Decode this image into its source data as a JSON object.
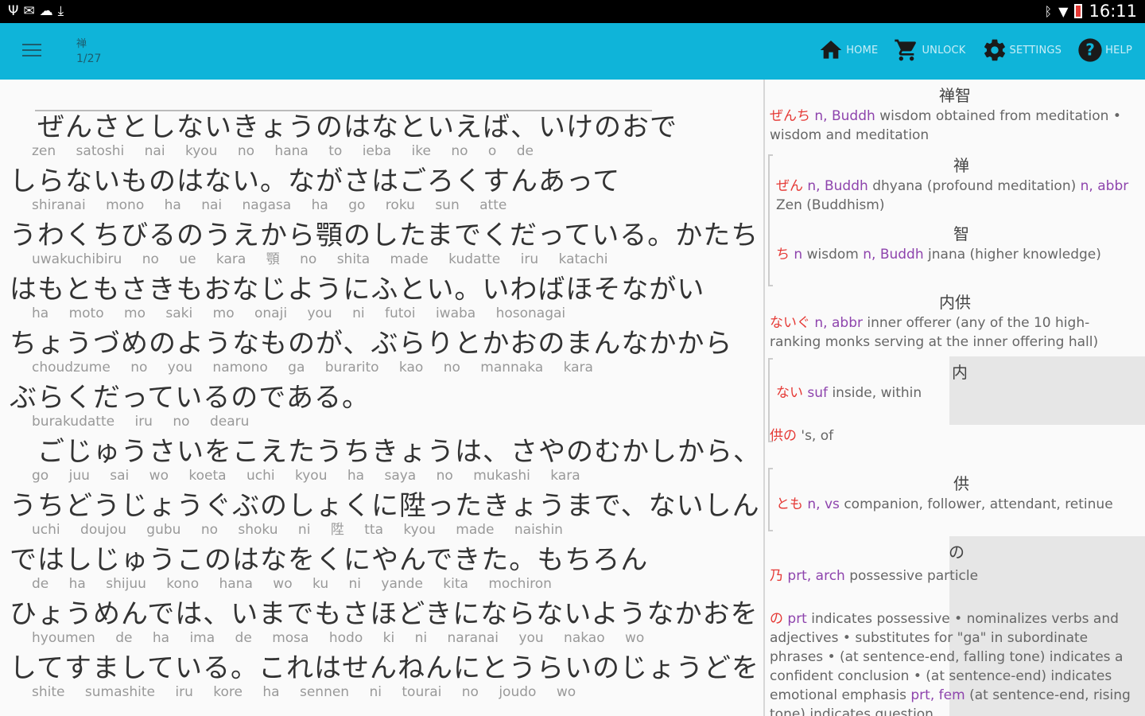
{
  "status_bar": {
    "left_icons": [
      "usb-icon",
      "email-icon",
      "cloud-upload-icon",
      "download-icon"
    ],
    "right_icons": [
      "bluetooth-icon",
      "wifi-icon",
      "battery-icon"
    ],
    "time": "16:11"
  },
  "app_bar": {
    "title": "禅",
    "subtitle": "1/27",
    "actions": [
      {
        "label": "HOME",
        "icon": "home-icon"
      },
      {
        "label": "UNLOCK",
        "icon": "cart-icon"
      },
      {
        "label": "SETTINGS",
        "icon": "gear-icon"
      },
      {
        "label": "HELP",
        "icon": "help-icon"
      }
    ]
  },
  "text_lines": [
    {
      "jp": "　ぜんさとしないきょうのはなといえば、いけのおで",
      "romaji": "zen satoshi nai kyou no hana to ieba ike no o de"
    },
    {
      "jp": "しらないものはない。ながさはごろくすんあって",
      "romaji": "shiranai mono ha nai nagasa ha go roku sun atte"
    },
    {
      "jp": "うわくちびるのうえから顎のしたまでくだっている。かたち",
      "romaji": "uwakuchibiru no ue kara 顎 no shita made kudatte iru katachi"
    },
    {
      "jp": "はもともさきもおなじようにふとい。いわばほそながい",
      "romaji": "ha moto mo saki mo onaji you ni futoi iwaba hosonagai"
    },
    {
      "jp": "ちょうづめのようなものが、ぶらりとかおのまんなかから",
      "romaji": "choudzume no you namono ga burarito kao no mannaka kara"
    },
    {
      "jp": "ぶらくだっているのである。",
      "romaji": "burakudatte iru no dearu"
    },
    {
      "jp": "　ごじゅうさいをこえたうちきょうは、さやのむかしから、",
      "romaji": "go juu sai wo koeta uchi kyou ha saya no mukashi kara"
    },
    {
      "jp": "うちどうじょうぐぶのしょくに陞ったきょうまで、ないしん",
      "romaji": "uchi doujou gubu no shoku ni 陞 tta kyou made naishin"
    },
    {
      "jp": "ではしじゅうこのはなをくにやんできた。もちろん",
      "romaji": "de ha shijuu kono hana wo ku ni yande kita mochiron"
    },
    {
      "jp": "ひょうめんでは、いまでもさほどきにならないようなかおを",
      "romaji": "hyoumen de ha ima de mosa hodo ki ni naranai you nakao wo"
    },
    {
      "jp": "してすましている。これはせんねんにとうらいのじょうどを",
      "romaji": "shite sumashite iru kore ha sennen ni tourai no joudo wo"
    }
  ],
  "dictionary": [
    {
      "kanji": "禅智",
      "reading": "ぜんち",
      "def": "n, Buddh wisdom obtained from meditation • wisdom and meditation"
    },
    {
      "kanji": "禅",
      "reading": "ぜん",
      "def": "n, Buddh dhyana (profound meditation) n, abbr Zen (Buddhism)"
    },
    {
      "kanji": "智",
      "reading": "ち",
      "def": "n wisdom n, Buddh jnana (higher knowledge)"
    },
    {
      "kanji": "内供",
      "reading": "ないぐ",
      "def": "n, abbr inner offerer (any of the 10 high-ranking monks serving at the inner offering hall)"
    },
    {
      "kanji": "内",
      "reading": "ない",
      "def": "suf inside, within"
    },
    {
      "kanji": "",
      "reading": "供の",
      "def": "'s, of"
    },
    {
      "kanji": "供",
      "reading": "とも",
      "def": "n, vs companion, follower, attendant, retinue"
    },
    {
      "kanji": "の",
      "reading": "乃",
      "def": "prt, arch possessive particle"
    },
    {
      "kanji": "",
      "reading": "の",
      "def": "prt indicates possessive • nominalizes verbs and adjectives • substitutes for \"ga\" in subordinate phrases • (at sentence-end, falling tone) indicates a confident conclusion • (at sentence-end) indicates emotional emphasis prt, fem (at sentence-end, rising tone) indicates question"
    }
  ],
  "colors": {
    "accent": "#0fb4d9",
    "reading": "#e53935",
    "pos": "#8e44ad"
  }
}
